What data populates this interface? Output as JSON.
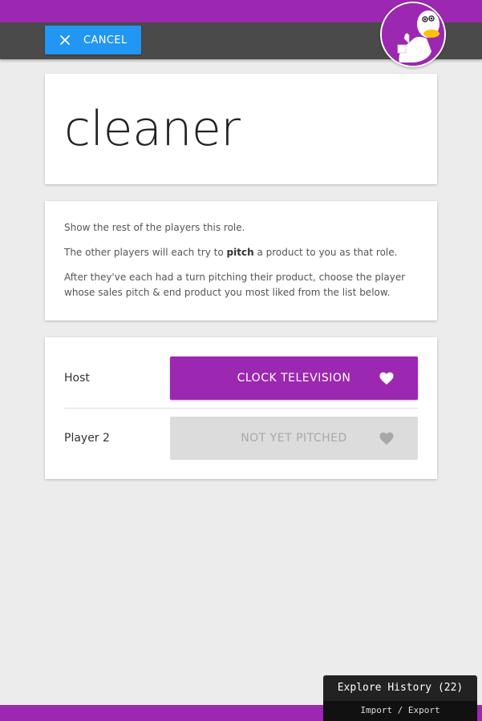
{
  "toolbar": {
    "cancel_label": "CANCEL",
    "cancel_icon": "close-icon"
  },
  "avatar": {
    "icon": "duck-thumbs-up-avatar",
    "color": "#9c27b0"
  },
  "role": {
    "word": "cleaner"
  },
  "instructions": {
    "line1": "Show the rest of the players this role.",
    "line2_prefix": "The other players will each try to ",
    "line2_bold": "pitch",
    "line2_suffix": " a product to you as that role.",
    "line3": "After they've each had a turn pitching their product, choose the player whose sales pitch & end product you most liked from the list below."
  },
  "players": [
    {
      "name": "Host",
      "button_label": "CLOCK TELEVISION",
      "state": "pitched",
      "icon": "heart-icon"
    },
    {
      "name": "Player 2",
      "button_label": "NOT YET PITCHED",
      "state": "not-pitched",
      "icon": "heart-icon"
    }
  ],
  "history": {
    "title": "Explore History (22)",
    "subtitle": "Import / Export"
  },
  "colors": {
    "accent": "#9c27b0",
    "cancel": "#2196f3",
    "toolbar": "#4a4a4a"
  }
}
